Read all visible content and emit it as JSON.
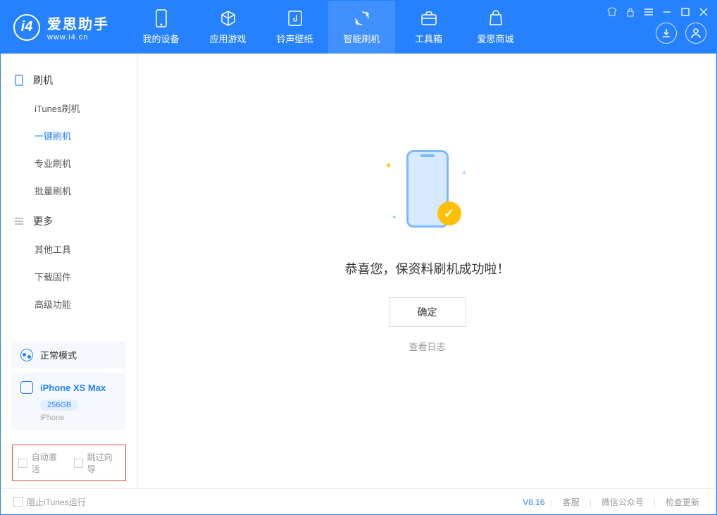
{
  "app": {
    "title": "爱思助手",
    "subtitle": "www.i4.cn"
  },
  "nav": {
    "items": [
      {
        "label": "我的设备"
      },
      {
        "label": "应用游戏"
      },
      {
        "label": "铃声壁纸"
      },
      {
        "label": "智能刷机"
      },
      {
        "label": "工具箱"
      },
      {
        "label": "爱思商城"
      }
    ]
  },
  "sidebar": {
    "flash_header": "刷机",
    "more_header": "更多",
    "flash_items": [
      {
        "label": "iTunes刷机"
      },
      {
        "label": "一键刷机"
      },
      {
        "label": "专业刷机"
      },
      {
        "label": "批量刷机"
      }
    ],
    "more_items": [
      {
        "label": "其他工具"
      },
      {
        "label": "下载固件"
      },
      {
        "label": "高级功能"
      }
    ],
    "status": "正常模式",
    "device": {
      "name": "iPhone XS Max",
      "storage": "256GB",
      "type": "iPhone"
    },
    "checks": {
      "auto_activate": "自动激活",
      "skip_guide": "跳过向导"
    }
  },
  "content": {
    "success_message": "恭喜您，保资料刷机成功啦！",
    "ok_button": "确定",
    "view_log": "查看日志"
  },
  "footer": {
    "block_itunes": "阻止iTunes运行",
    "version": "V8.16",
    "links": {
      "support": "客服",
      "wechat": "微信公众号",
      "update": "检查更新"
    }
  }
}
